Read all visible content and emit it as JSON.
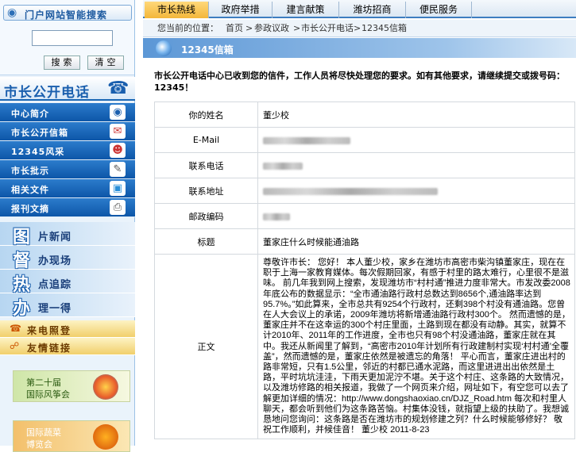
{
  "search": {
    "title": "门户网站智能搜索",
    "input_value": "",
    "search_btn": "搜索",
    "clear_btn": "清空"
  },
  "sidebar": {
    "heading": "市长公开电话",
    "menu": [
      {
        "label": "中心简介",
        "icon": "globe-icon"
      },
      {
        "label": "市长公开信箱",
        "icon": "mailbox-icon"
      },
      {
        "label": "12345风采",
        "icon": "people-icon"
      },
      {
        "label": "市长批示",
        "icon": "pen-icon"
      },
      {
        "label": "相关文件",
        "icon": "folder-icon"
      },
      {
        "label": "报刊文摘",
        "icon": "printer-icon"
      }
    ],
    "features": [
      {
        "char": "图",
        "rest": "片新闻"
      },
      {
        "char": "督",
        "rest": "办现场"
      },
      {
        "char": "热",
        "rest": "点追踪"
      },
      {
        "char": "办",
        "rest": "理一得"
      }
    ],
    "yellow": [
      {
        "label": "来电照登",
        "icon": "phone-icon"
      },
      {
        "label": "友情链接",
        "icon": "link-icon"
      }
    ],
    "ads": [
      {
        "line1": "第二十届",
        "line2": "国际风筝会"
      },
      {
        "line1": "国际蔬菜",
        "line2": "博览会"
      }
    ]
  },
  "tabs": [
    "市长热线",
    "政府举措",
    "建言献策",
    "潍坊招商",
    "便民服务"
  ],
  "breadcrumb": {
    "prefix": "您当前的位置：",
    "items": [
      "首页",
      "参政议政",
      "市长公开电话",
      "12345信箱"
    ],
    "sep": ">"
  },
  "section_title": "12345信箱",
  "notice": "市长公开电话中心已收到您的信件，工作人员将尽快处理您的要求。如有其他要求，请继续提交或拨号码：12345！",
  "form": {
    "rows": [
      {
        "label": "你的姓名",
        "value": "董少校"
      },
      {
        "label": "E-Mail",
        "value": ""
      },
      {
        "label": "联系电话",
        "value": ""
      },
      {
        "label": "联系地址",
        "value": ""
      },
      {
        "label": "邮政编码",
        "value": ""
      },
      {
        "label": "标题",
        "value": "董家庄什么时候能通油路"
      },
      {
        "label": "正文",
        "value": "尊敬许市长： 您好！ 本人董少校，家乡在潍坊市高密市柴沟镇董家庄，现在在职于上海一家教育媒体。每次假期回家，有感于村里的路太难行，心里很不是滋味。 前几年我到网上搜索，发现潍坊市“村村通”推进力度非常大。市发改委2008年底公布的数据显示：“全市通油路行政村总数达到8656个,通油路率达到95.7%。”如此算来，全市总共有9254个行政村，还剩398个村没有通油路。您曾在人大会议上的承诺，2009年潍坊将新增通油路行政村300个。 然而遗憾的是，董家庄并不在这幸运的300个村庄里面，土路到现在都没有动静。其实，就算不计2010年、2011年的工作进度，全市也只有98个村没通油路，董家庄就在其中。我还从新闻里了解到，“高密市2010年计划所有行政建制村实现‘村村通’全覆盖”，然而遗憾的是，董家庄依然是被遗忘的角落！ 平心而言，董家庄进出村的路非常短，只有1.5公里，邻近的村都已通水泥路，而这里进进出出依然是土路，平时坑坑洼洼，下雨天更加泥泞不堪。关于这个村庄、这条路的大致情况，以及潍坊修路的相关报道，我做了一个网页来介绍，网址如下，有空您可以去了解更加详细的情况：http://www.dongshaoxiao.cn/DJZ_Road.htm 每次和村里人聊天，都会听到他们为这条路苦恼。村集体没钱，就指望上级的扶助了。我想诚恳地问您询问：这条路是否在潍坊市的规划修建之列？什么时候能够修好？ 敬祝工作顺利，并候佳音！ 董少校 2011-8-23"
      }
    ]
  },
  "colors": {
    "brand_blue": "#1a5fae",
    "tab_active": "#f3b73a",
    "menu_blue": "#0d56a8"
  }
}
